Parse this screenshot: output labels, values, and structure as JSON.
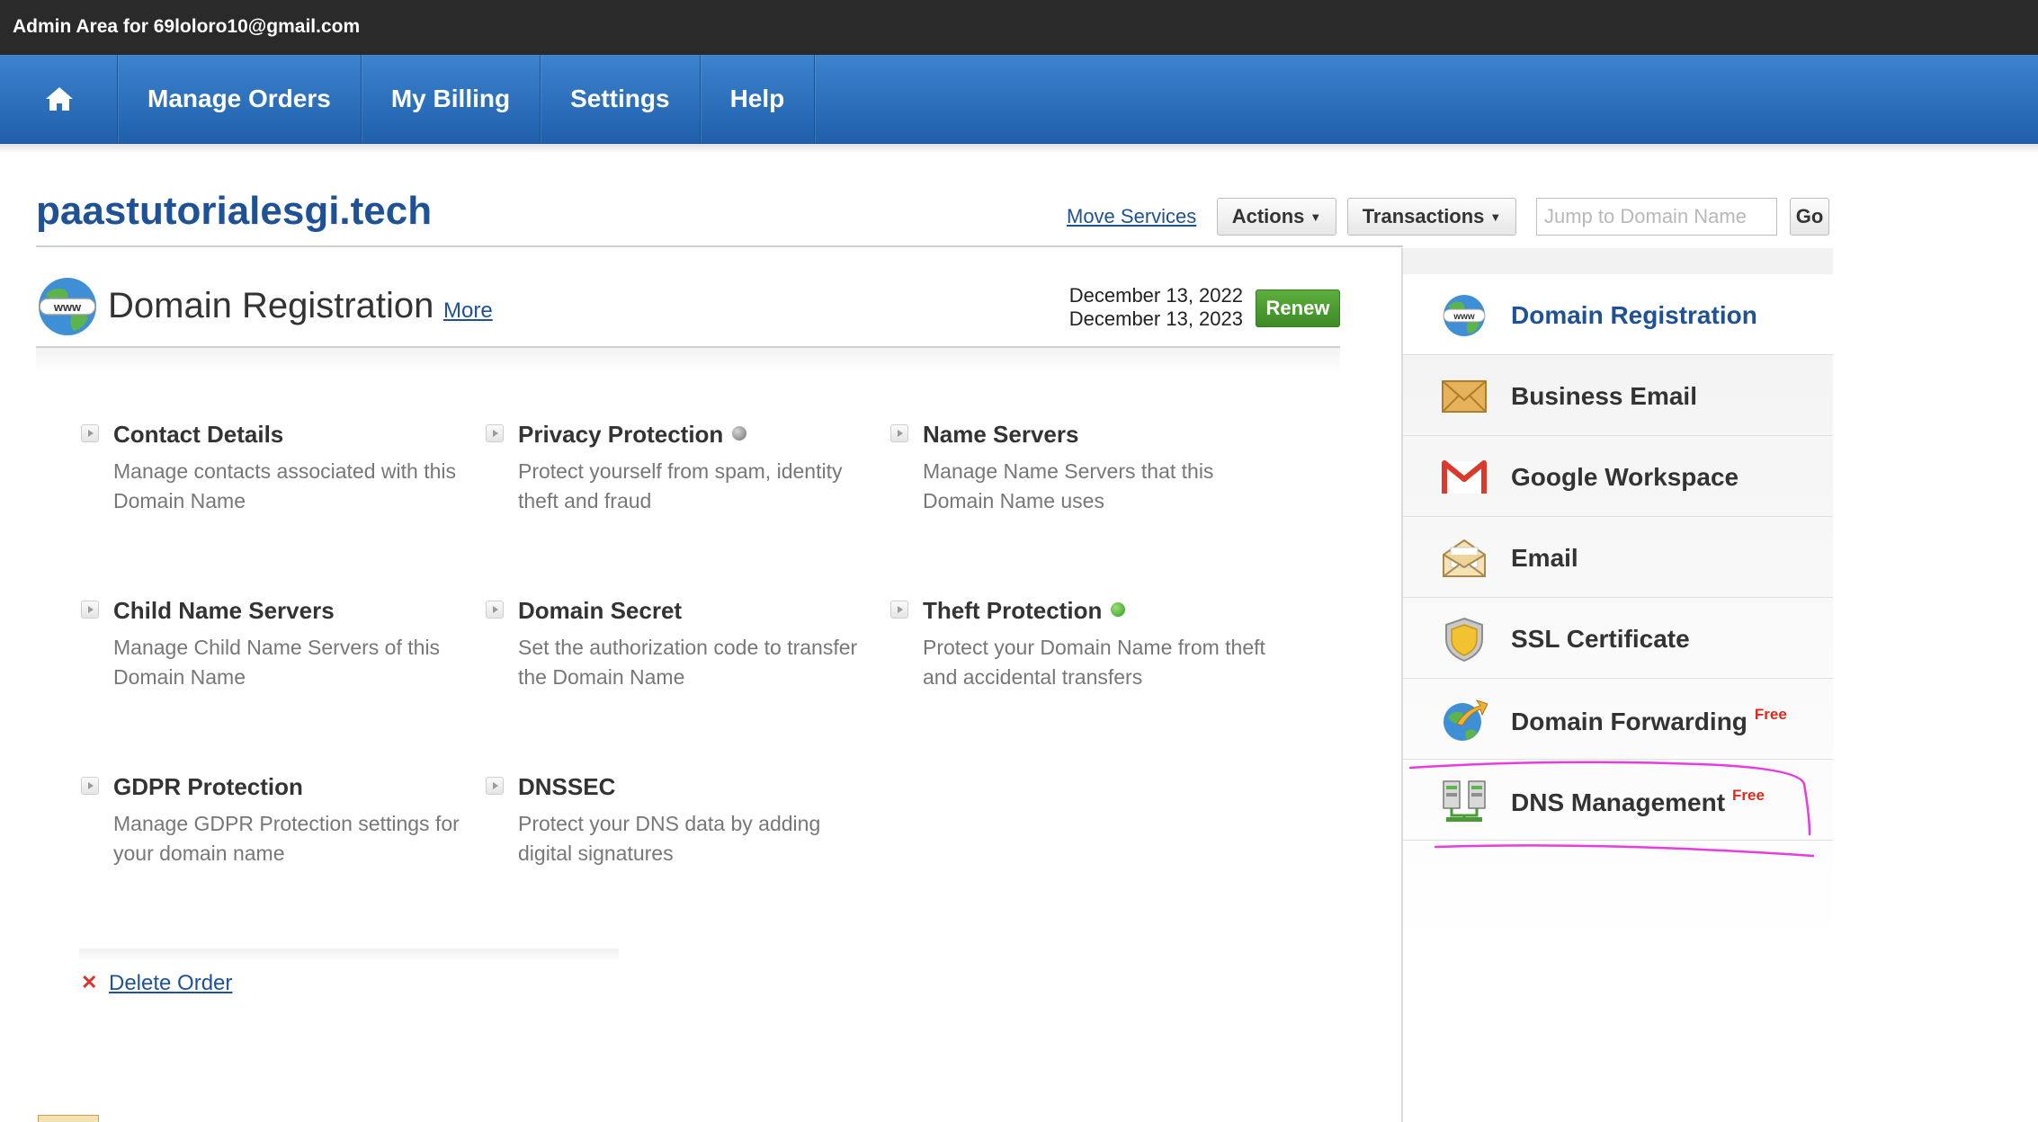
{
  "admin_bar": {
    "text": "Admin Area for 69loloro10@gmail.com"
  },
  "nav": {
    "home_icon": "home-icon",
    "items": [
      {
        "label": "Manage Orders"
      },
      {
        "label": "My Billing"
      },
      {
        "label": "Settings"
      },
      {
        "label": "Help"
      }
    ]
  },
  "domain": {
    "name": "paastutorialesgi.tech",
    "move_services": "Move Services",
    "actions_label": "Actions",
    "transactions_label": "Transactions",
    "jump_placeholder": "Jump to Domain Name",
    "go_label": "Go"
  },
  "section": {
    "icon": "www-globe-icon",
    "title": "Domain Registration",
    "more_link": "More",
    "date_start": "December 13, 2022",
    "date_end": "December 13, 2023",
    "renew_label": "Renew"
  },
  "features": [
    {
      "title": "Contact Details",
      "desc": "Manage contacts associated with this Domain Name",
      "status": ""
    },
    {
      "title": "Privacy Protection",
      "desc": "Protect yourself from spam, identity theft and fraud",
      "status": "off"
    },
    {
      "title": "Name Servers",
      "desc": "Manage Name Servers that this Domain Name uses",
      "status": ""
    },
    {
      "title": "Child Name Servers",
      "desc": "Manage Child Name Servers of this Domain Name",
      "status": ""
    },
    {
      "title": "Domain Secret",
      "desc": "Set the authorization code to transfer the Domain Name",
      "status": ""
    },
    {
      "title": "Theft Protection",
      "desc": "Protect your Domain Name from theft and accidental transfers",
      "status": "on"
    },
    {
      "title": "GDPR Protection",
      "desc": "Manage GDPR Protection settings for your domain name",
      "status": ""
    },
    {
      "title": "DNSSEC",
      "desc": "Protect your DNS data by adding digital signatures",
      "status": ""
    }
  ],
  "delete_order": "Delete Order",
  "sidebar": {
    "items": [
      {
        "label": "Domain Registration",
        "icon": "www-globe-icon",
        "active": true,
        "badge": ""
      },
      {
        "label": "Business Email",
        "icon": "envelope-icon",
        "active": false,
        "badge": ""
      },
      {
        "label": "Google Workspace",
        "icon": "gmail-icon",
        "active": false,
        "badge": ""
      },
      {
        "label": "Email",
        "icon": "open-mail-icon",
        "active": false,
        "badge": ""
      },
      {
        "label": "SSL Certificate",
        "icon": "shield-icon",
        "active": false,
        "badge": ""
      },
      {
        "label": "Domain Forwarding",
        "icon": "forwarding-globe-icon",
        "active": false,
        "badge": "Free"
      },
      {
        "label": "DNS Management",
        "icon": "dns-servers-icon",
        "active": false,
        "badge": "Free"
      }
    ]
  },
  "colors": {
    "nav_blue": "#2f74c2",
    "link_blue": "#1f5196",
    "renew_green": "#4c9d33",
    "free_red": "#e0291d",
    "annotation_magenta": "#e83be0"
  }
}
